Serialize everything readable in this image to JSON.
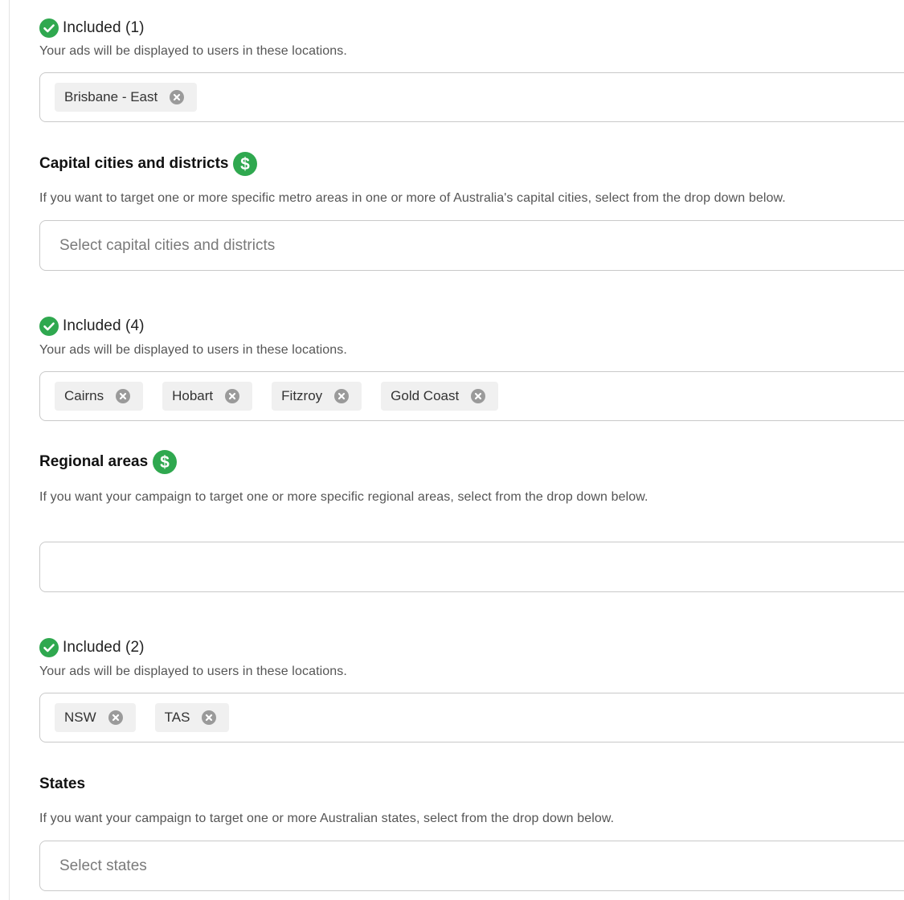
{
  "sections": [
    {
      "included": {
        "label": "Included (1)",
        "description": "Your ads will be displayed to users in these locations.",
        "chips": [
          "Brisbane - East"
        ]
      },
      "title": "Capital cities and districts",
      "paid": true,
      "description": "If you want to target one or more specific metro areas in one or more of Australia's capital cities, select from the drop down below.",
      "placeholder": "Select capital cities and districts"
    },
    {
      "included": {
        "label": "Included (4)",
        "description": "Your ads will be displayed to users in these locations.",
        "chips": [
          "Cairns",
          "Hobart",
          "Fitzroy",
          "Gold Coast"
        ]
      },
      "title": "Regional areas",
      "paid": true,
      "description": "If you want your campaign to target one or more specific regional areas, select from the drop down below.",
      "placeholder": ""
    },
    {
      "included": {
        "label": "Included (2)",
        "description": "Your ads will be displayed to users in these locations.",
        "chips": [
          "NSW",
          "TAS"
        ]
      },
      "title": "States",
      "paid": false,
      "description": "If you want your campaign to target one or more Australian states, select from the drop down below.",
      "placeholder": "Select states"
    }
  ],
  "icons": {
    "included": "check-circle-icon",
    "remove": "close-circle-icon",
    "paid": "dollar-circle-icon"
  },
  "colors": {
    "accent_green": "#2fa84f",
    "chip_bg": "#f0f0f0",
    "remove_icon": "#9a9a9a",
    "border": "#c9c9c9"
  }
}
